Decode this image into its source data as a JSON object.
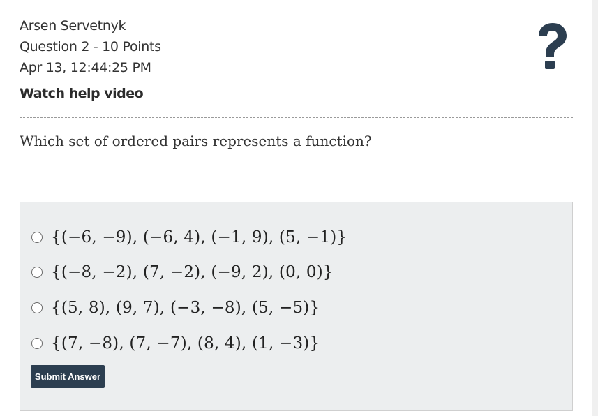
{
  "header": {
    "student_name": "Arsen Servetnyk",
    "question_info": "Question 2 - 10 Points",
    "timestamp": "Apr 13, 12:44:25 PM",
    "help_link_label": "Watch help video",
    "help_icon": "question-mark-icon"
  },
  "question": {
    "prompt": "Which set of ordered pairs represents a function?"
  },
  "choices": [
    {
      "label": "{(−6, −9), (−6, 4), (−1, 9), (5, −1)}",
      "selected": false
    },
    {
      "label": "{(−8, −2), (7, −2), (−9, 2), (0, 0)}",
      "selected": false
    },
    {
      "label": "{(5, 8), (9, 7), (−3, −8), (5, −5)}",
      "selected": false
    },
    {
      "label": "{(7, −8), (7, −7), (8, 4), (1, −3)}",
      "selected": false
    }
  ],
  "submit_label": "Submit Answer",
  "colors": {
    "submit_background": "#2c3e50",
    "answer_box_background": "#eceeef",
    "help_icon": "#2c3e50"
  }
}
